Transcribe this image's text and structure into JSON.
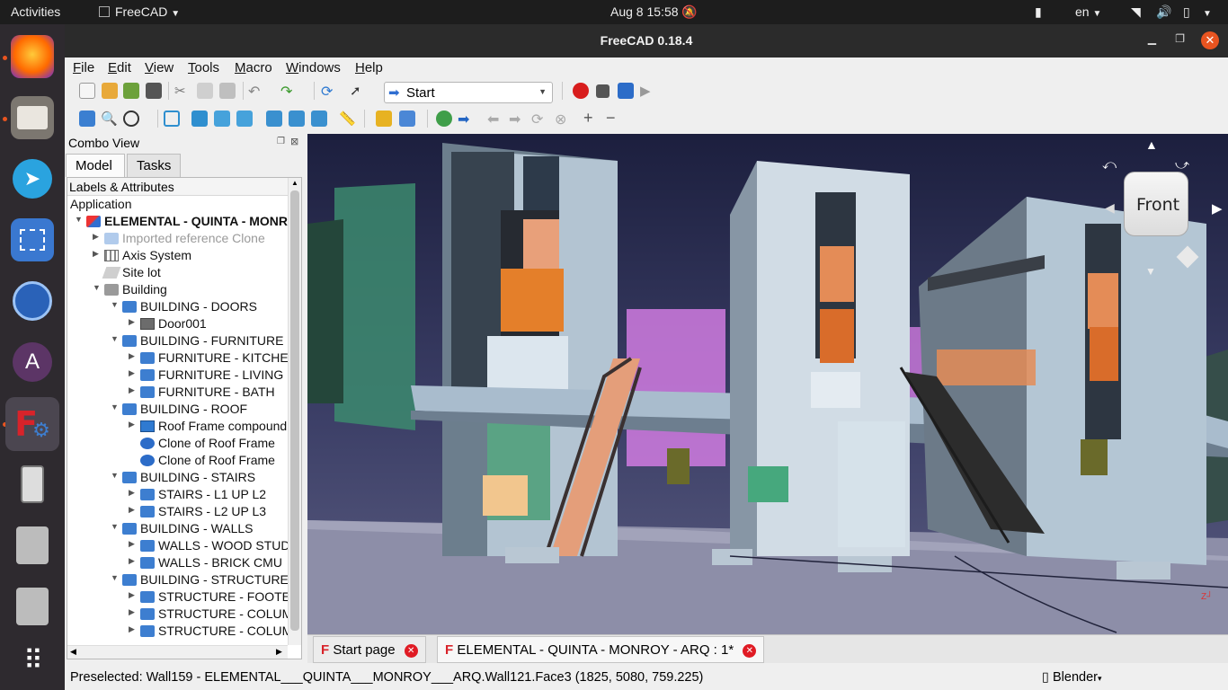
{
  "topbar": {
    "activities": "Activities",
    "app_name": "FreeCAD",
    "datetime": "Aug 8  15:58",
    "language": "en"
  },
  "dock": {
    "apps": [
      "firefox-icon",
      "files-icon",
      "telegram-icon",
      "screenshot-icon",
      "vpn-icon",
      "app-center-icon",
      "freecad-icon",
      "phone-icon",
      "disc-icon",
      "disc-icon",
      "app-grid-icon"
    ]
  },
  "window": {
    "title": "FreeCAD 0.18.4"
  },
  "menu": {
    "items": [
      {
        "ul": "F",
        "rest": "ile"
      },
      {
        "ul": "E",
        "rest": "dit"
      },
      {
        "ul": "V",
        "rest": "iew"
      },
      {
        "ul": "T",
        "rest": "ools"
      },
      {
        "ul": "M",
        "rest": "acro"
      },
      {
        "ul": "W",
        "rest": "indows"
      },
      {
        "ul": "H",
        "rest": "elp"
      }
    ]
  },
  "toolbar": {
    "workbench": "Start"
  },
  "combo": {
    "title": "Combo View",
    "tabs": [
      "Model",
      "Tasks"
    ],
    "header": "Labels & Attributes",
    "application": "Application",
    "rows": [
      {
        "label": "ELEMENTAL - QUINTA - MONROY - ARQ",
        "depth": 0,
        "arrow": "down",
        "icon": "document-icon",
        "bold": true
      },
      {
        "label": "Imported reference Clone",
        "depth": 1,
        "arrow": "right",
        "icon": "folder-icon",
        "dim": true
      },
      {
        "label": "Axis System",
        "depth": 1,
        "arrow": "right",
        "icon": "axis-icon"
      },
      {
        "label": "Site lot",
        "depth": 1,
        "arrow": "",
        "icon": "site-icon"
      },
      {
        "label": "Building",
        "depth": 1,
        "arrow": "down",
        "icon": "building-icon"
      },
      {
        "label": "BUILDING - DOORS",
        "depth": 2,
        "arrow": "down",
        "icon": "folder-icon"
      },
      {
        "label": "Door001",
        "depth": 3,
        "arrow": "right",
        "icon": "door-icon"
      },
      {
        "label": "BUILDING - FURNITURE",
        "depth": 2,
        "arrow": "down",
        "icon": "folder-icon"
      },
      {
        "label": "FURNITURE - KITCHEN",
        "depth": 3,
        "arrow": "right",
        "icon": "folder-icon"
      },
      {
        "label": "FURNITURE - LIVING",
        "depth": 3,
        "arrow": "right",
        "icon": "folder-icon"
      },
      {
        "label": "FURNITURE - BATH",
        "depth": 3,
        "arrow": "right",
        "icon": "folder-icon"
      },
      {
        "label": "BUILDING - ROOF",
        "depth": 2,
        "arrow": "down",
        "icon": "folder-icon"
      },
      {
        "label": "Roof Frame compound",
        "depth": 3,
        "arrow": "right",
        "icon": "part-icon"
      },
      {
        "label": "Clone of Roof Frame",
        "depth": 3,
        "arrow": "",
        "icon": "clone-icon"
      },
      {
        "label": "Clone of Roof Frame",
        "depth": 3,
        "arrow": "",
        "icon": "clone-icon"
      },
      {
        "label": "BUILDING - STAIRS",
        "depth": 2,
        "arrow": "down",
        "icon": "folder-icon"
      },
      {
        "label": "STAIRS - L1 UP L2",
        "depth": 3,
        "arrow": "right",
        "icon": "folder-icon"
      },
      {
        "label": "STAIRS - L2 UP L3",
        "depth": 3,
        "arrow": "right",
        "icon": "folder-icon"
      },
      {
        "label": "BUILDING - WALLS",
        "depth": 2,
        "arrow": "down",
        "icon": "folder-icon"
      },
      {
        "label": "WALLS - WOOD STUD",
        "depth": 3,
        "arrow": "right",
        "icon": "folder-icon"
      },
      {
        "label": "WALLS - BRICK CMU",
        "depth": 3,
        "arrow": "right",
        "icon": "folder-icon"
      },
      {
        "label": "BUILDING - STRUCTURE",
        "depth": 2,
        "arrow": "down",
        "icon": "folder-icon"
      },
      {
        "label": "STRUCTURE - FOOTERS",
        "depth": 3,
        "arrow": "right",
        "icon": "folder-icon"
      },
      {
        "label": "STRUCTURE - COLUMNS",
        "depth": 3,
        "arrow": "right",
        "icon": "folder-icon"
      },
      {
        "label": "STRUCTURE - COLUMNS",
        "depth": 3,
        "arrow": "right",
        "icon": "folder-icon"
      }
    ]
  },
  "viewport": {
    "navcube_label": "Front"
  },
  "doc_tabs": [
    {
      "label": "Start page"
    },
    {
      "label": "ELEMENTAL - QUINTA - MONROY - ARQ : 1*"
    }
  ],
  "status": {
    "message": "Preselected: Wall159 - ELEMENTAL___QUINTA___MONROY___ARQ.Wall121.Face3 (1825, 5080, 759.225)",
    "navigation": "Blender"
  }
}
